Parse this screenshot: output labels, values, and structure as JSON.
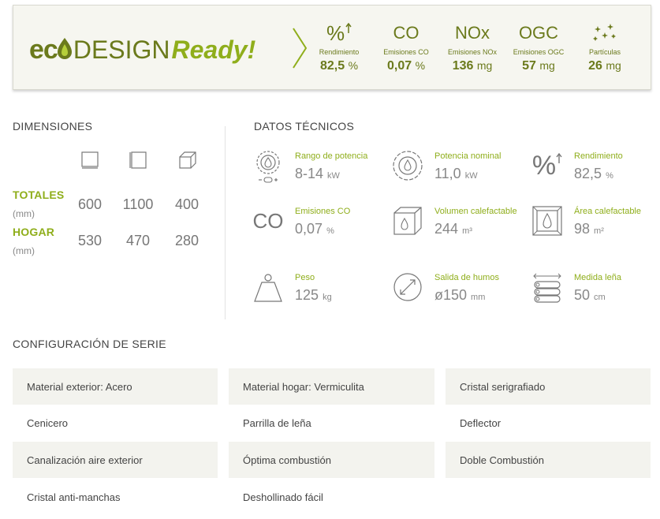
{
  "banner": {
    "logo": {
      "eco_prefix": "ec",
      "design": "DESIGN",
      "ready": "Ready!"
    },
    "metrics": [
      {
        "symbol": "%",
        "label": "Rendimiento",
        "value": "82,5",
        "unit": "%"
      },
      {
        "symbol": "CO",
        "label": "Emisiones CO",
        "value": "0,07",
        "unit": "%"
      },
      {
        "symbol": "NOx",
        "label": "Emisiones NOx",
        "value": "136",
        "unit": "mg"
      },
      {
        "symbol": "OGC",
        "label": "Emisiones OGC",
        "value": "57",
        "unit": "mg"
      },
      {
        "symbol": "",
        "label": "Partículas",
        "value": "26",
        "unit": "mg"
      }
    ]
  },
  "dimensions": {
    "title": "DIMENSIONES",
    "icons": [
      "width-icon",
      "height-icon",
      "depth-icon"
    ],
    "rows": [
      {
        "label": "TOTALES",
        "unit": "(mm)",
        "values": [
          "600",
          "1100",
          "400"
        ]
      },
      {
        "label": "HOGAR",
        "unit": "(mm)",
        "values": [
          "530",
          "470",
          "280"
        ]
      }
    ]
  },
  "technical": {
    "title": "DATOS TÉCNICOS",
    "items": [
      {
        "icon": "power-range-icon",
        "label": "Rango de potencia",
        "value": "8-14",
        "unit": "kW"
      },
      {
        "icon": "nominal-power-icon",
        "label": "Potencia nominal",
        "value": "11,0",
        "unit": "kW"
      },
      {
        "icon": "efficiency-icon",
        "label": "Rendimiento",
        "value": "82,5",
        "unit": "%"
      },
      {
        "icon": "co-emissions-icon",
        "label": "Emisiones CO",
        "value": "0,07",
        "unit": "%"
      },
      {
        "icon": "heating-volume-icon",
        "label": "Volumen calefactable",
        "value": "244",
        "unit": "m³"
      },
      {
        "icon": "heating-area-icon",
        "label": "Área calefactable",
        "value": "98",
        "unit": "m²"
      },
      {
        "icon": "weight-icon",
        "label": "Peso",
        "value": "125",
        "unit": "kg"
      },
      {
        "icon": "flue-outlet-icon",
        "label": "Salida de humos",
        "value": "ø150",
        "unit": "mm"
      },
      {
        "icon": "log-size-icon",
        "label": "Medida leña",
        "value": "50",
        "unit": "cm"
      }
    ],
    "co_symbol": "CO"
  },
  "configuration": {
    "title": "CONFIGURACIÓN DE SERIE",
    "items": [
      "Material exterior: Acero",
      "Material hogar: Vermiculita",
      "Cristal serigrafiado",
      "Cenicero",
      "Parrilla de leña",
      "Deflector",
      "Canalización aire exterior",
      "Óptima combustión",
      "Doble Combustión",
      "Cristal anti-manchas",
      "Deshollinado fácil"
    ]
  },
  "colors": {
    "brand_dark": "#6b7a1c",
    "brand_light": "#8fae1b",
    "row_shade": "#f3f3ee"
  }
}
